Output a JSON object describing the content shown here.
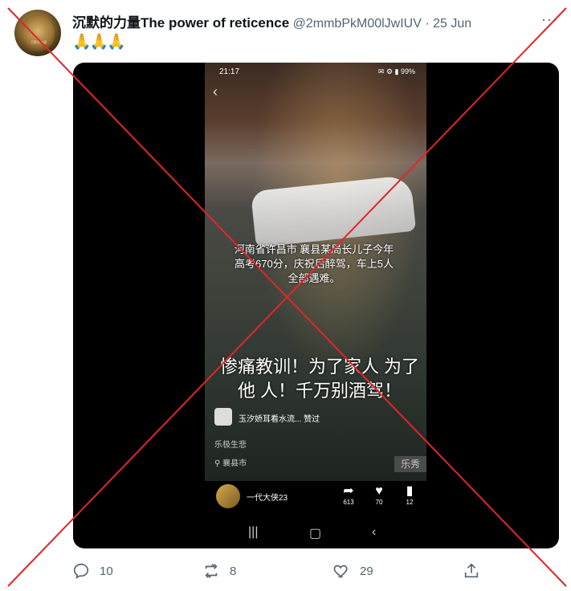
{
  "tweet": {
    "author_name": "沉默的力量The power of reticence",
    "handle": "@2mmbPkM00lJwIUV",
    "separator": "·",
    "date": "25 Jun",
    "text": "🙏🙏🙏",
    "more_icon": "more-icon",
    "avatar_caption": "沉默的力量"
  },
  "video": {
    "status_time": "21:17",
    "status_icons": "✉ ⚙ ▮ 99%",
    "caption_lines": "河南省许昌市 襄县某局长儿子今年高考670分，庆祝后醉驾，车上5人全部遇难。",
    "headline": "惨痛教训！为了家人 为了他 人！千万别酒驾！",
    "music_text": "玉汐娇耳看水流... 赞过",
    "subtag": "乐极生悲",
    "location": "襄县市",
    "watermark": "乐秀",
    "uploader": "一代大侠23",
    "shares": "613",
    "likes": "70",
    "comments": "12"
  },
  "actions": {
    "replies": "10",
    "retweets": "8",
    "likes": "29"
  },
  "colors": {
    "text": "#0f1419",
    "secondary": "#536471",
    "cross": "#e0262b"
  }
}
